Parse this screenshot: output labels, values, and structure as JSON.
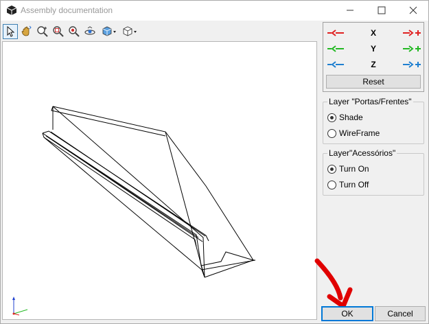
{
  "window": {
    "title": "Assembly documentation",
    "icon": "cube-icon",
    "controls": [
      "minimize-icon",
      "maximize-icon",
      "close-icon"
    ]
  },
  "toolbar": {
    "tools": [
      "select-arrow-icon",
      "pan-hand-icon",
      "zoom-in-icon",
      "zoom-window-icon",
      "zoom-fit-icon",
      "rotate-eye-icon",
      "shaded-view-dropdown-icon",
      "wireframe-view-dropdown-icon"
    ],
    "active_tool": "select-arrow-icon"
  },
  "axis_panel": {
    "rows": [
      {
        "label": "X",
        "color": "#e02020"
      },
      {
        "label": "Y",
        "color": "#22b822"
      },
      {
        "label": "Z",
        "color": "#1e7fd0"
      }
    ],
    "reset_label": "Reset"
  },
  "layer_portas": {
    "legend": "Layer \"Portas/Frentes\"",
    "options": [
      {
        "label": "Shade",
        "checked": true
      },
      {
        "label": "WireFrame",
        "checked": false
      }
    ]
  },
  "layer_acessorios": {
    "legend": "Layer\"Acessórios\"",
    "options": [
      {
        "label": "Turn On",
        "checked": true
      },
      {
        "label": "Turn Off",
        "checked": false
      }
    ]
  },
  "footer": {
    "ok_label": "OK",
    "cancel_label": "Cancel"
  },
  "colors": {
    "accent": "#0078d7",
    "annotation_arrow": "#e00000"
  }
}
